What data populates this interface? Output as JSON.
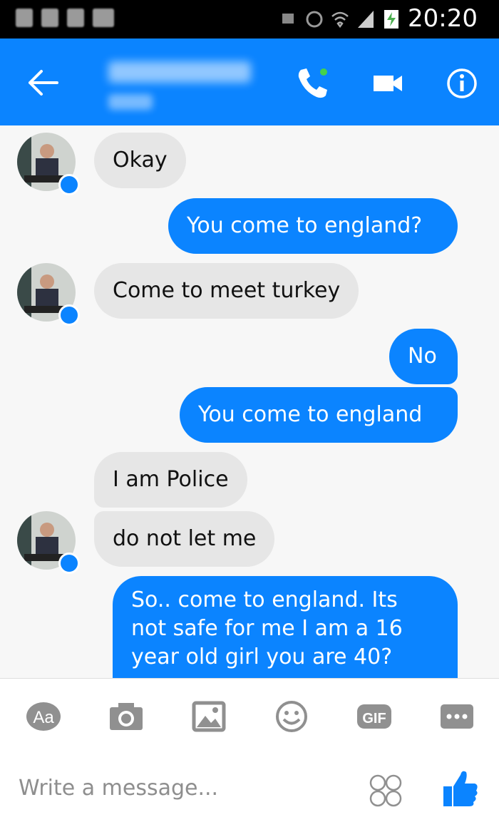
{
  "status_bar": {
    "time": "20:20"
  },
  "header": {
    "contact_name": "Servet Turan",
    "contact_status": "Now"
  },
  "messages": [
    {
      "from": "them",
      "text": "Okay"
    },
    {
      "from": "me",
      "text": "You come to england?"
    },
    {
      "from": "them",
      "text": "Come to meet turkey"
    },
    {
      "from": "me",
      "text": "No"
    },
    {
      "from": "me",
      "text": "You come to england"
    },
    {
      "from": "them",
      "text": "I am Police"
    },
    {
      "from": "them",
      "text": "do not let me"
    },
    {
      "from": "me",
      "text": "So.. come to england.  Its not safe for me I am a 16 year old girl you are 40?"
    }
  ],
  "composer": {
    "text_tool_label": "Aa",
    "gif_label": "GIF",
    "placeholder": "Write a message..."
  },
  "colors": {
    "accent": "#0b84ff",
    "incoming_bubble": "#e6e6e6"
  }
}
